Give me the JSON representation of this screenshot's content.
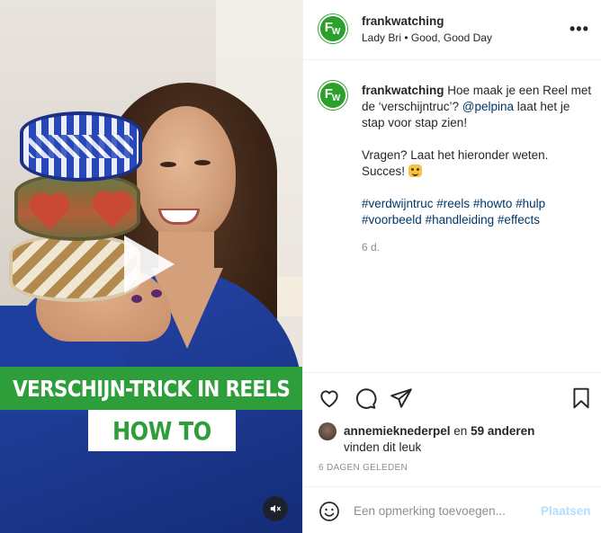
{
  "post": {
    "account": "frankwatching",
    "avatar_letters": {
      "big": "F",
      "small": "W"
    },
    "audio": "Lady Bri • Good, Good Day",
    "more_label": "•••",
    "brand_color": "#2ba02b"
  },
  "media": {
    "banner_title": "VERSCHIJN-TRICK IN REELS",
    "banner_subtitle": "HOW TO",
    "banner_color": "#2e9e3a",
    "mute_icon": "speaker-muted-icon"
  },
  "caption": {
    "username": "frankwatching",
    "text_before_mention": " Hoe maak je een Reel met de ‘verschijntruc’? ",
    "mention": "@pelpina",
    "text_after_mention": " laat het je stap voor stap zien!",
    "question": "Vragen? Laat het hieronder weten. Succes! ",
    "hashtags": [
      "#verdwijntruc",
      "#reels",
      "#howto",
      "#hulp",
      "#voorbeeld",
      "#handleiding",
      "#effects"
    ],
    "time_ago": "6 d."
  },
  "actions": {
    "like_icon": "heart-icon",
    "comment_icon": "comment-icon",
    "share_icon": "send-icon",
    "save_icon": "bookmark-icon"
  },
  "likes": {
    "liker": "annemieknederpel",
    "connector": " en ",
    "others": "59 anderen",
    "suffix": "vinden dit leuk"
  },
  "date_label": "6 DAGEN GELEDEN",
  "comment_box": {
    "placeholder": "Een opmerking toevoegen...",
    "post_label": "Plaatsen",
    "emoji_icon": "smiley-icon"
  }
}
